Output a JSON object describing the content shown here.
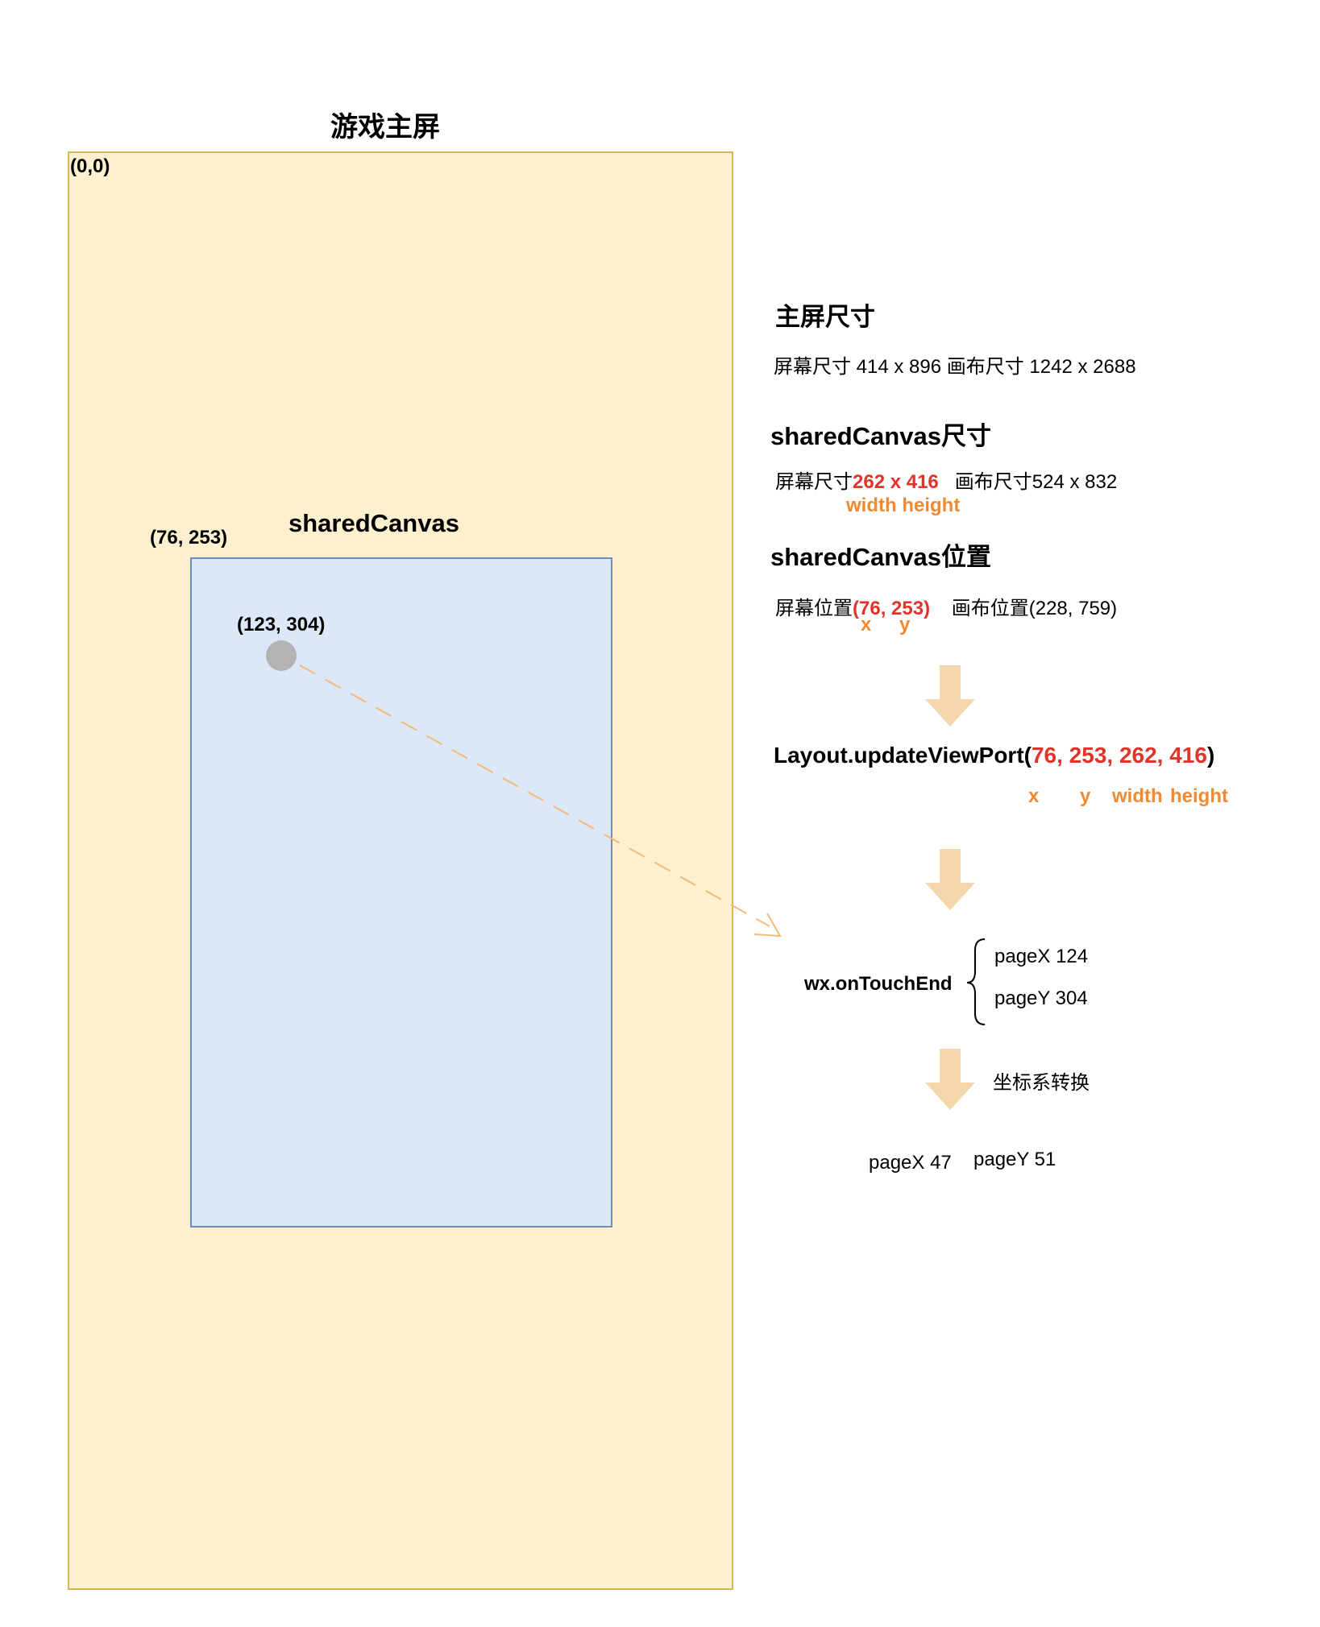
{
  "main_screen": {
    "title": "游戏主屏",
    "origin_label": "(0,0)"
  },
  "shared_canvas": {
    "title": "sharedCanvas",
    "corner_label": "(76, 253)",
    "touch_label": "(123, 304)"
  },
  "info": {
    "main_size": {
      "heading": "主屏尺寸",
      "line": "屏幕尺寸 414 x 896  画布尺寸 1242 x 2688"
    },
    "canvas_size": {
      "heading": "sharedCanvas尺寸",
      "prefix": "屏幕尺寸",
      "value": "262 x 416",
      "suffix": "画布尺寸524 x 832",
      "hint": "width height"
    },
    "canvas_pos": {
      "heading": "sharedCanvas位置",
      "prefix": "屏幕位置",
      "value": "(76, 253)",
      "suffix": "画布位置(228, 759)",
      "hint_x": "x",
      "hint_y": "y"
    }
  },
  "layout_call": {
    "prefix": "Layout.updateViewPort(",
    "args": "76, 253, 262, 416",
    "suffix": ")",
    "hint_x": "x",
    "hint_y": "y",
    "hint_width": "width",
    "hint_height": "height"
  },
  "touch": {
    "event": "wx.onTouchEnd",
    "page_x": "pageX 124",
    "page_y": "pageY 304"
  },
  "transform": {
    "label": "坐标系转换",
    "result_x": "pageX 47",
    "result_y": "pageY 51"
  },
  "colors": {
    "main_fill": "#fcf0cf",
    "main_border": "#d6b656",
    "canvas_fill": "#dce8f8",
    "canvas_border": "#6c8ebf",
    "accent_red": "#e0332a",
    "accent_orange": "#f08a30",
    "arrow_fill": "#f5d7ae",
    "point_fill": "#b3b3b3"
  }
}
